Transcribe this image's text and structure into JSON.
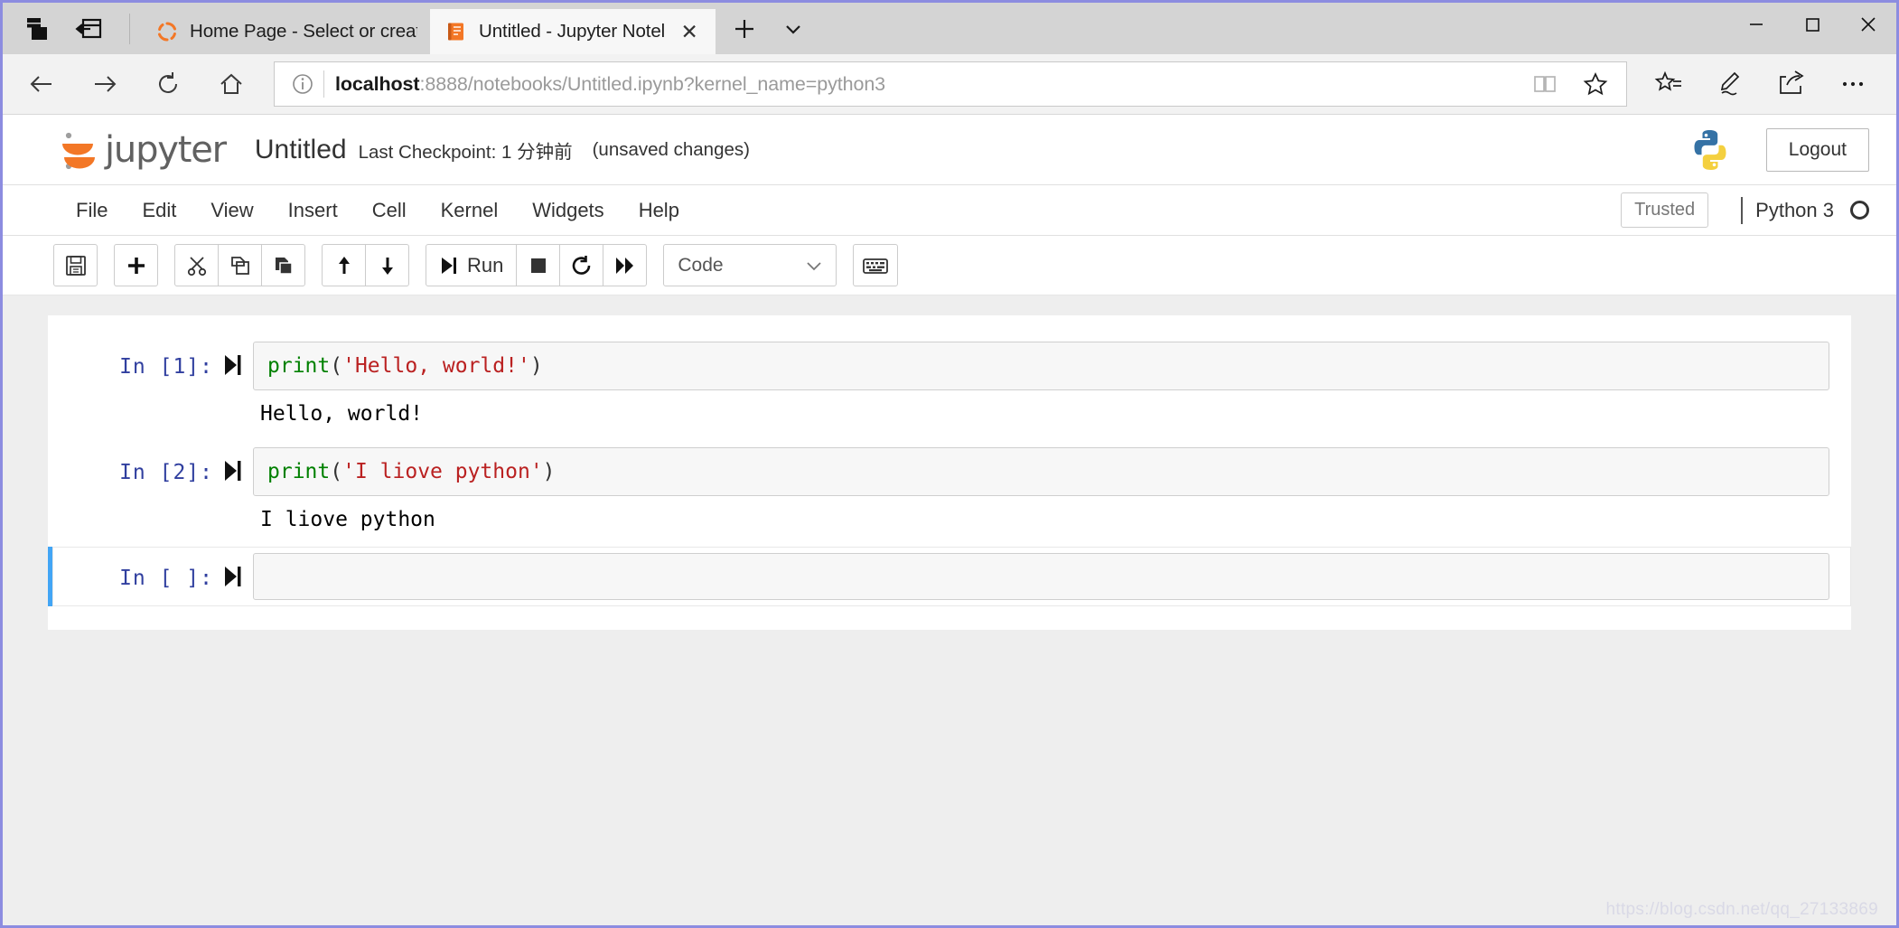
{
  "browser": {
    "lead_icons": [
      {
        "name": "tab-preview-icon",
        "label": "Show tab previews"
      },
      {
        "name": "set-tabs-aside-icon",
        "label": "Set these tabs aside"
      }
    ],
    "tabs": [
      {
        "title": "Home Page - Select or creat",
        "favicon": "jupyter-spinner-icon",
        "active": false,
        "closable": false
      },
      {
        "title": "Untitled - Jupyter Notel",
        "favicon": "jupyter-notebook-icon",
        "active": true,
        "closable": true,
        "close_label": "✕"
      }
    ],
    "new_tab_label": "+",
    "tab_list_label": "∨",
    "window_controls": {
      "minimize": "—",
      "maximize": "□",
      "close": "✕"
    },
    "nav": {
      "back_label": "Back",
      "forward_label": "Forward",
      "refresh_label": "Refresh",
      "home_label": "Home"
    },
    "address": {
      "info_label": "i",
      "url_host": "localhost",
      "url_rest": ":8888/notebooks/Untitled.ipynb?kernel_name=python3",
      "url_full": "localhost:8888/notebooks/Untitled.ipynb?kernel_name=python3",
      "reading_view_label": "Reading view",
      "favorite_label": "Add to favorites"
    },
    "trail_icons": [
      {
        "name": "favorites-hub-icon",
        "label": "Favorites, reading list, history"
      },
      {
        "name": "web-notes-icon",
        "label": "Make a Web Note"
      },
      {
        "name": "share-icon",
        "label": "Share"
      },
      {
        "name": "more-icon",
        "label": "Settings and more"
      }
    ]
  },
  "jupyter": {
    "brand": "jupyter",
    "notebook_name": "Untitled",
    "checkpoint": "Last Checkpoint: 1 分钟前",
    "dirty_state": "(unsaved changes)",
    "logout_label": "Logout",
    "menu": [
      "File",
      "Edit",
      "View",
      "Insert",
      "Cell",
      "Kernel",
      "Widgets",
      "Help"
    ],
    "trusted_label": "Trusted",
    "kernel_name": "Python 3",
    "kernel_status": "idle",
    "toolbar": {
      "save_label": "Save and Checkpoint",
      "insert_label": "Insert cell below",
      "cut_label": "Cut selected cells",
      "copy_label": "Copy selected cells",
      "paste_label": "Paste cells below",
      "moveup_label": "Move selected cells up",
      "movedown_label": "Move selected cells down",
      "run_label": "Run",
      "stop_label": "Interrupt the kernel",
      "restart_label": "Restart the kernel",
      "restart_run_all_label": "Restart the kernel and re-run the notebook",
      "celltype_value": "Code",
      "celltype_caret": "∨",
      "command_palette_label": "Open the command palette"
    }
  },
  "notebook": {
    "cells": [
      {
        "prompt": "In [1]:",
        "selected": false,
        "source_segments": [
          {
            "text": "print",
            "type": "fn"
          },
          {
            "text": "(",
            "type": "punct"
          },
          {
            "text": "'Hello, world!'",
            "type": "str"
          },
          {
            "text": ")",
            "type": "punct"
          }
        ],
        "source_plain": "print('Hello, world!')",
        "output": "Hello, world!"
      },
      {
        "prompt": "In [2]:",
        "selected": false,
        "source_segments": [
          {
            "text": "print",
            "type": "fn"
          },
          {
            "text": "(",
            "type": "punct"
          },
          {
            "text": "'I liove python'",
            "type": "str"
          },
          {
            "text": ")",
            "type": "punct"
          }
        ],
        "source_plain": "print('I liove python')",
        "output": "I liove python"
      },
      {
        "prompt": "In [ ]:",
        "selected": true,
        "source_segments": [],
        "source_plain": "",
        "output": ""
      }
    ]
  },
  "watermark": "https://blog.csdn.net/qq_27133869",
  "colors": {
    "jupyter_orange": "#F37726",
    "selected_cell_blue": "#42A5F5",
    "prompt_blue": "#303F9F",
    "string_red": "#BA2121",
    "function_green": "#008000",
    "window_border": "#8c8ce0",
    "notebook_bg": "#eeeeee"
  }
}
